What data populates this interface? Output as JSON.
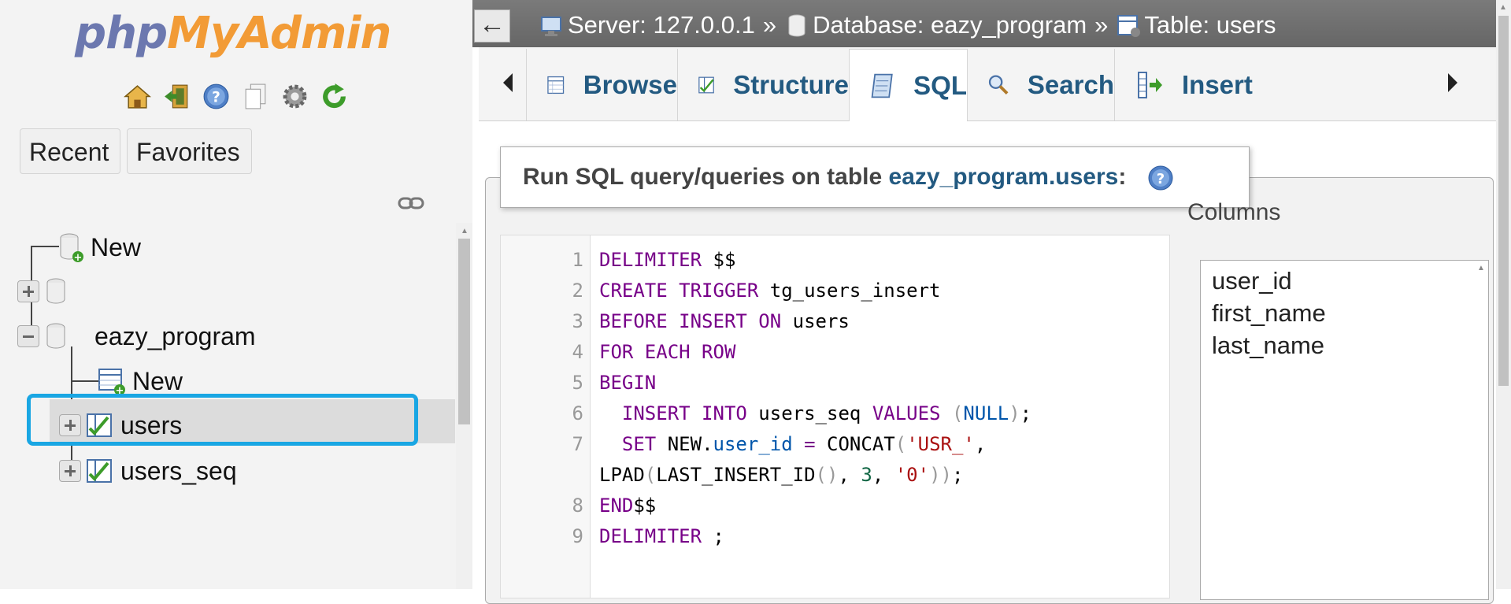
{
  "nav": {
    "logo": {
      "php": "php",
      "my": "My",
      "admin": "Admin"
    },
    "icons": [
      "home-icon",
      "logout-icon",
      "help-icon",
      "docs-icon",
      "settings-icon",
      "reload-icon"
    ],
    "recent_label": "Recent",
    "favorites_label": "Favorites",
    "tree": {
      "new_root": "New",
      "database": "eazy_program",
      "db_new": "New",
      "tables": [
        "users",
        "users_seq"
      ]
    }
  },
  "topbar": {
    "back": "←",
    "server": "Server: 127.0.0.1",
    "database": "Database: eazy_program",
    "table": "Table: users",
    "sep": "»"
  },
  "tabs": [
    {
      "label": "Browse",
      "icon": "browse-icon"
    },
    {
      "label": "Structure",
      "icon": "structure-icon"
    },
    {
      "label": "SQL",
      "icon": "sql-icon",
      "active": true
    },
    {
      "label": "Search",
      "icon": "search-icon"
    },
    {
      "label": "Insert",
      "icon": "insert-icon"
    }
  ],
  "sql": {
    "legend_prefix": "Run SQL query/queries on table ",
    "legend_table": "eazy_program.users",
    "legend_suffix": ":",
    "line_numbers": [
      "1",
      "2",
      "3",
      "4",
      "5",
      "6",
      "7",
      "8",
      "9"
    ]
  },
  "columns": {
    "label": "Columns",
    "items": [
      "user_id",
      "first_name",
      "last_name"
    ]
  },
  "colors": {
    "accent": "#235a81",
    "highlight": "#19a6e3",
    "keyword": "#770088"
  }
}
